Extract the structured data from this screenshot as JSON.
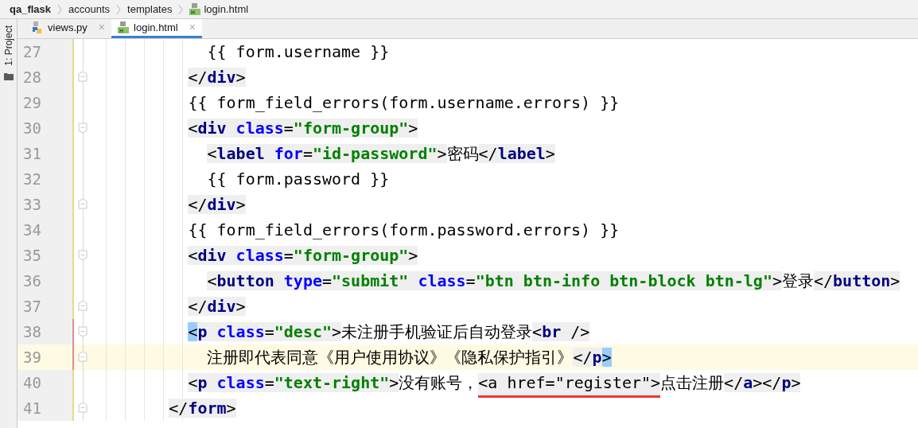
{
  "breadcrumb": [
    {
      "text": "qa_flask",
      "bold": true,
      "kind": "project"
    },
    {
      "text": "accounts",
      "bold": false,
      "kind": "folder"
    },
    {
      "text": "templates",
      "bold": false,
      "kind": "folder"
    },
    {
      "text": "login.html",
      "bold": false,
      "kind": "html"
    }
  ],
  "tool_strip": {
    "label": "1: Project"
  },
  "tabs": [
    {
      "label": "views.py",
      "kind": "python",
      "selected": false,
      "close": "×"
    },
    {
      "label": "login.html",
      "kind": "html",
      "selected": true,
      "close": "×"
    }
  ],
  "lines": [
    {
      "number": "27",
      "color": "#e3dd8e",
      "fold_start": false,
      "fold_end": false,
      "current": false,
      "tokens": [
        {
          "kind": "tpl",
          "text": "{{ form.username }}"
        }
      ]
    },
    {
      "number": "28",
      "color": "#e3dd8e",
      "fold_start": false,
      "fold_end": true,
      "current": false,
      "tokens": [
        {
          "kind": "punct",
          "text": "</"
        },
        {
          "kind": "name",
          "text": "div"
        },
        {
          "kind": "punct",
          "text": ">"
        }
      ]
    },
    {
      "number": "29",
      "color": "#e3dd8e",
      "fold_start": false,
      "fold_end": false,
      "current": false,
      "tokens": [
        {
          "kind": "tpl",
          "text": "{{ form_field_errors(form.username.errors) }}"
        }
      ]
    },
    {
      "number": "30",
      "color": "#e3dd8e",
      "fold_start": true,
      "fold_end": false,
      "current": false,
      "tokens": [
        {
          "kind": "punct",
          "text": "<"
        },
        {
          "kind": "name",
          "text": "div"
        },
        {
          "kind": "attr",
          "text": " class"
        },
        {
          "kind": "punct",
          "text": "="
        },
        {
          "kind": "value",
          "text": "\"form-group\""
        },
        {
          "kind": "punct",
          "text": ">"
        }
      ]
    },
    {
      "number": "31",
      "color": "#e3dd8e",
      "fold_start": false,
      "fold_end": false,
      "current": false,
      "tokens": [
        {
          "kind": "punct",
          "text": "<"
        },
        {
          "kind": "name",
          "text": "label"
        },
        {
          "kind": "attr",
          "text": " for"
        },
        {
          "kind": "punct",
          "text": "="
        },
        {
          "kind": "value",
          "text": "\"id-password\""
        },
        {
          "kind": "punct",
          "text": ">"
        },
        {
          "kind": "text",
          "text": "密码"
        },
        {
          "kind": "punct",
          "text": "</"
        },
        {
          "kind": "name",
          "text": "label"
        },
        {
          "kind": "punct",
          "text": ">"
        }
      ]
    },
    {
      "number": "32",
      "color": "#e3dd8e",
      "fold_start": false,
      "fold_end": false,
      "current": false,
      "tokens": [
        {
          "kind": "tpl",
          "text": "{{ form.password }}"
        }
      ]
    },
    {
      "number": "33",
      "color": "#e3dd8e",
      "fold_start": false,
      "fold_end": true,
      "current": false,
      "tokens": [
        {
          "kind": "punct",
          "text": "</"
        },
        {
          "kind": "name",
          "text": "div"
        },
        {
          "kind": "punct",
          "text": ">"
        }
      ]
    },
    {
      "number": "34",
      "color": "#e3dd8e",
      "fold_start": false,
      "fold_end": false,
      "current": false,
      "tokens": [
        {
          "kind": "tpl",
          "text": "{{ form_field_errors(form.password.errors) }}"
        }
      ]
    },
    {
      "number": "35",
      "color": "#e3dd8e",
      "fold_start": true,
      "fold_end": false,
      "current": false,
      "tokens": [
        {
          "kind": "punct",
          "text": "<"
        },
        {
          "kind": "name",
          "text": "div"
        },
        {
          "kind": "attr",
          "text": " class"
        },
        {
          "kind": "punct",
          "text": "="
        },
        {
          "kind": "value",
          "text": "\"form-group\""
        },
        {
          "kind": "punct",
          "text": ">"
        }
      ]
    },
    {
      "number": "36",
      "color": "#e3dd8e",
      "fold_start": false,
      "fold_end": false,
      "current": false,
      "tokens": [
        {
          "kind": "punct",
          "text": "<"
        },
        {
          "kind": "name",
          "text": "button"
        },
        {
          "kind": "attr",
          "text": " type"
        },
        {
          "kind": "punct",
          "text": "="
        },
        {
          "kind": "value",
          "text": "\"submit\""
        },
        {
          "kind": "attr",
          "text": " class"
        },
        {
          "kind": "punct",
          "text": "="
        },
        {
          "kind": "value",
          "text": "\"btn btn-info btn-block btn-lg\""
        },
        {
          "kind": "punct",
          "text": ">"
        },
        {
          "kind": "text",
          "text": "登录"
        },
        {
          "kind": "punct",
          "text": "</"
        },
        {
          "kind": "name",
          "text": "button"
        },
        {
          "kind": "punct",
          "text": ">"
        }
      ]
    },
    {
      "number": "37",
      "color": "#e3dd8e",
      "fold_start": false,
      "fold_end": true,
      "current": false,
      "tokens": [
        {
          "kind": "punct",
          "text": "</"
        },
        {
          "kind": "name",
          "text": "div"
        },
        {
          "kind": "punct",
          "text": ">"
        }
      ]
    },
    {
      "number": "38",
      "color": "#e08e8e",
      "fold_start": true,
      "fold_end": false,
      "current": false,
      "tokens": [
        {
          "kind": "match",
          "text": "<"
        },
        {
          "kind": "name",
          "text": "p"
        },
        {
          "kind": "attr",
          "text": " class"
        },
        {
          "kind": "punct",
          "text": "="
        },
        {
          "kind": "value",
          "text": "\"desc\""
        },
        {
          "kind": "punct",
          "text": ">"
        },
        {
          "kind": "text",
          "text": "未注册手机验证后自动登录"
        },
        {
          "kind": "punct",
          "text": "<"
        },
        {
          "kind": "name",
          "text": "br"
        },
        {
          "kind": "punct",
          "text": " />"
        }
      ]
    },
    {
      "number": "39",
      "color": "#e08e8e",
      "fold_start": false,
      "fold_end": true,
      "current": true,
      "tokens": [
        {
          "kind": "text",
          "text": "注册即代表同意《用户使用协议》《隐私保护指引》"
        },
        {
          "kind": "punct",
          "text": "</"
        },
        {
          "kind": "name",
          "text": "p"
        },
        {
          "kind": "match",
          "text": ">"
        }
      ]
    },
    {
      "number": "40",
      "color": "#e3dd8e",
      "fold_start": false,
      "fold_end": false,
      "current": false,
      "tokens": [
        {
          "kind": "punct",
          "text": "<"
        },
        {
          "kind": "name",
          "text": "p"
        },
        {
          "kind": "attr",
          "text": " class"
        },
        {
          "kind": "punct",
          "text": "="
        },
        {
          "kind": "value",
          "text": "\"text-right\""
        },
        {
          "kind": "punct",
          "text": ">"
        },
        {
          "kind": "text",
          "text": "没有账号，"
        },
        {
          "kind": "mark",
          "text": "<a href=\"register\">"
        },
        {
          "kind": "text",
          "text": "点击注册"
        },
        {
          "kind": "punct",
          "text": "</"
        },
        {
          "kind": "name",
          "text": "a"
        },
        {
          "kind": "punct",
          "text": "></"
        },
        {
          "kind": "name",
          "text": "p"
        },
        {
          "kind": "punct",
          "text": ">"
        }
      ]
    },
    {
      "number": "41",
      "color": "#e3dd8e",
      "fold_start": false,
      "fold_end": true,
      "current": false,
      "tokens": [
        {
          "kind": "punct",
          "text": "</"
        },
        {
          "kind": "name",
          "text": "form"
        },
        {
          "kind": "punct",
          "text": ">"
        }
      ]
    }
  ]
}
